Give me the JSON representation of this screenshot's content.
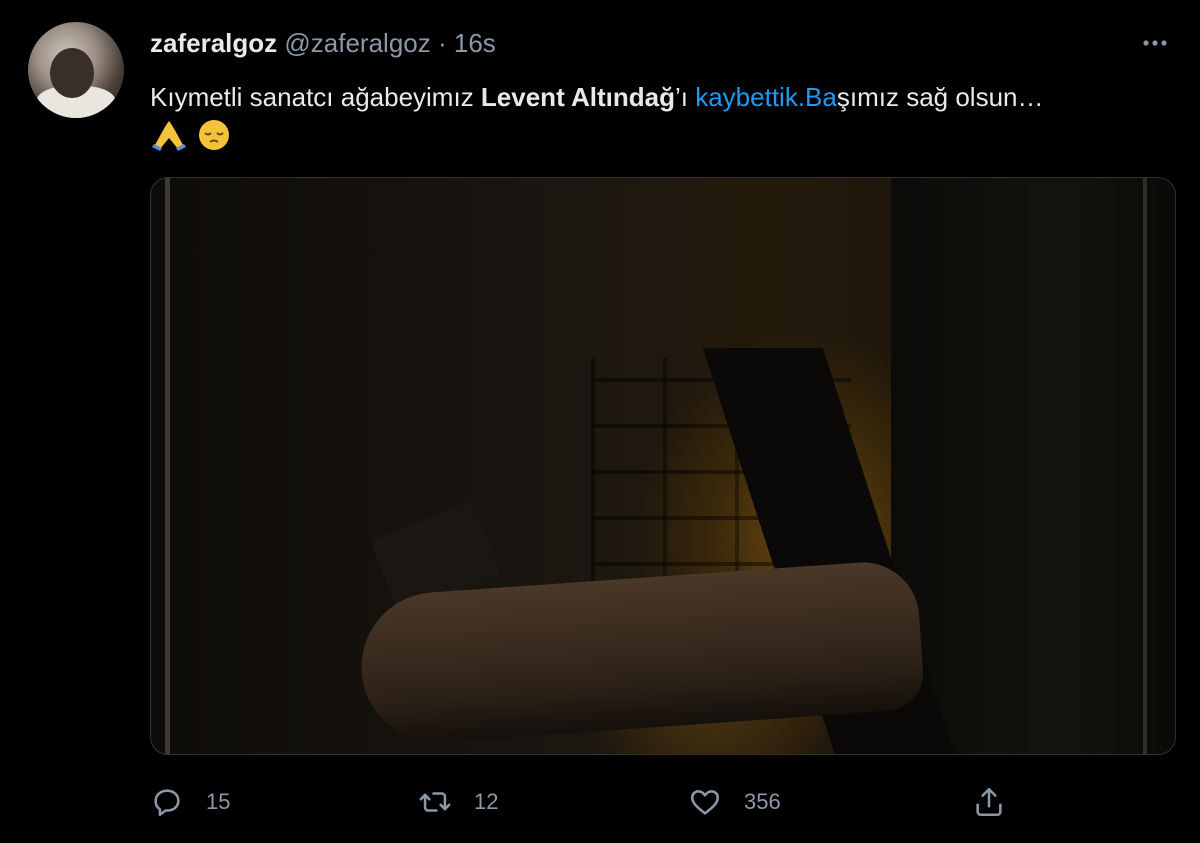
{
  "tweet": {
    "display_name": "zaferalgoz",
    "handle": "@zaferalgoz",
    "separator": "·",
    "time": "16s",
    "text_part1": "Kıymetli sanatcı ağabeyimız ",
    "text_bold": "Levent Altındağ",
    "text_part2": "’ı ",
    "text_link": "kaybettik.Ba",
    "text_part3": "şımız sağ olsun…",
    "emoji_1": "🙏",
    "emoji_2": "😔",
    "more_icon": "more-horizontal-icon"
  },
  "actions": {
    "reply_count": "15",
    "retweet_count": "12",
    "like_count": "356"
  },
  "colors": {
    "background": "#000000",
    "text": "#e7e9ea",
    "secondary": "#8b98a5",
    "link": "#1d9bf0"
  }
}
